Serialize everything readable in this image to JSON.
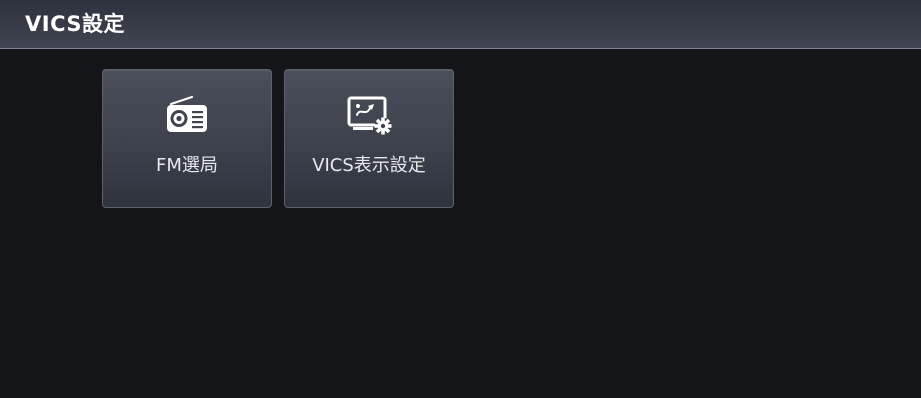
{
  "header": {
    "title": "VICS設定"
  },
  "menu": {
    "items": [
      {
        "label": "FM選局",
        "icon": "radio-icon"
      },
      {
        "label": "VICS表示設定",
        "icon": "display-settings-icon"
      }
    ]
  },
  "colors": {
    "background": "#141518",
    "header": "#373c48",
    "tile": "#40444e",
    "text": "#ffffff"
  }
}
